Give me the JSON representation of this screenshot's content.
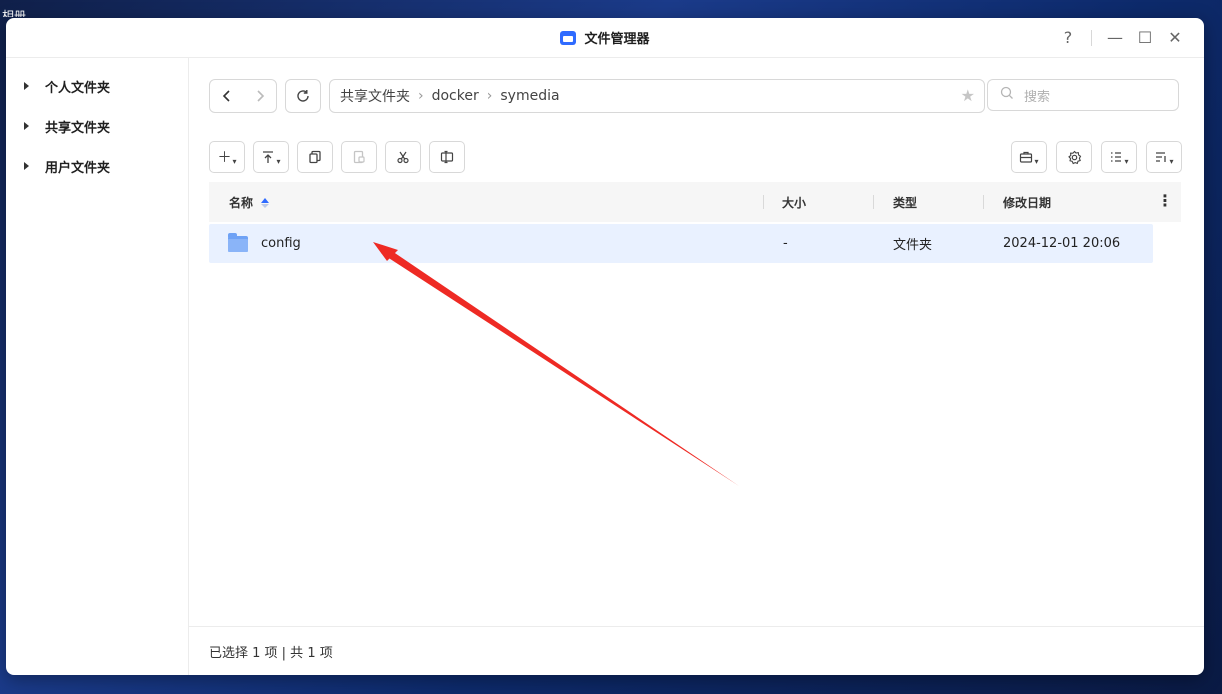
{
  "desktop": {
    "label": "相册"
  },
  "window": {
    "title": "文件管理器"
  },
  "window_controls": {
    "help": "?",
    "minimize": "—",
    "maximize": "☐",
    "close": "✕"
  },
  "sidebar": {
    "items": [
      {
        "label": "个人文件夹"
      },
      {
        "label": "共享文件夹"
      },
      {
        "label": "用户文件夹"
      }
    ]
  },
  "path": {
    "crumbs": [
      "共享文件夹",
      "docker",
      "symedia"
    ]
  },
  "search": {
    "placeholder": "搜索"
  },
  "table": {
    "headers": {
      "name": "名称",
      "size": "大小",
      "type": "类型",
      "modified": "修改日期"
    },
    "rows": [
      {
        "name": "config",
        "size": "-",
        "type": "文件夹",
        "modified": "2024-12-01 20:06"
      }
    ]
  },
  "status": {
    "text": "已选择 1 项 | 共 1 项"
  },
  "colors": {
    "accent": "#2f6bff",
    "selected_row": "#e9f1ff",
    "annotation_arrow": "#ee2a24"
  }
}
